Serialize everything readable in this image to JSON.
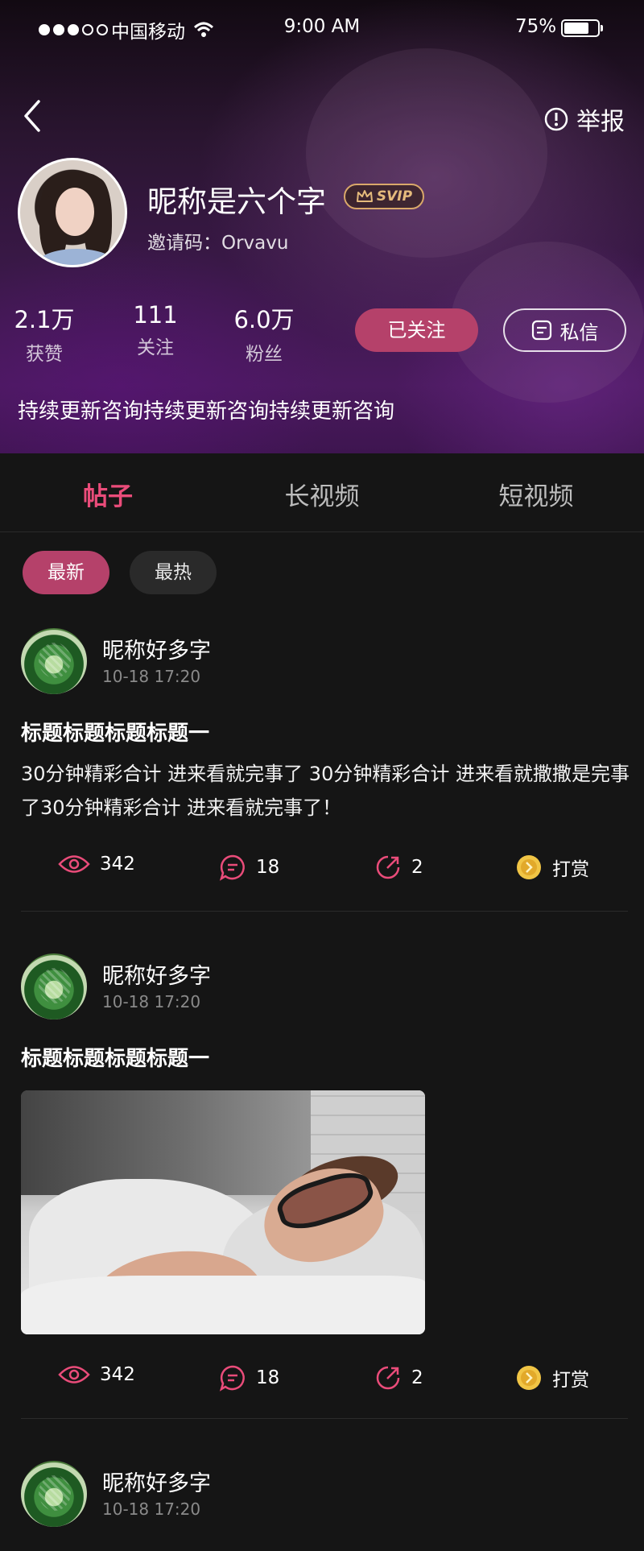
{
  "status_bar": {
    "carrier": "中国移动",
    "time": "9:00 AM",
    "battery": "75%"
  },
  "header": {
    "report_label": "举报",
    "nickname": "昵称是六个字",
    "badge": "SVIP",
    "invite_code": "邀请码：Orvavu",
    "stats": [
      {
        "value": "2.1万",
        "label": "获赞"
      },
      {
        "value": "111",
        "label": "关注"
      },
      {
        "value": "6.0万",
        "label": "粉丝"
      }
    ],
    "follow_label": "已关注",
    "message_label": "私信",
    "bio": "持续更新咨询持续更新咨询持续更新咨询"
  },
  "tabs": [
    "帖子",
    "长视频",
    "短视频"
  ],
  "filters": [
    "最新",
    "最热"
  ],
  "posts": [
    {
      "author": "昵称好多字",
      "time": "10-18 17:20",
      "title": "标题标题标题标题一",
      "body": "30分钟精彩合计 进来看就完事了  30分钟精彩合计 进来看就撒撒是完事了30分钟精彩合计 进来看就完事了！",
      "views": "342",
      "comments": "18",
      "shares": "2",
      "tip_label": "打赏"
    },
    {
      "author": "昵称好多字",
      "time": "10-18 17:20",
      "title": "标题标题标题标题一",
      "views": "342",
      "comments": "18",
      "shares": "2",
      "tip_label": "打赏"
    },
    {
      "author": "昵称好多字",
      "time": "10-18 17:20"
    }
  ],
  "colors": {
    "accent": "#ea4c7a",
    "button_pink": "#b5416a",
    "background": "#151515",
    "svip_gold": "#e5bb7c"
  }
}
